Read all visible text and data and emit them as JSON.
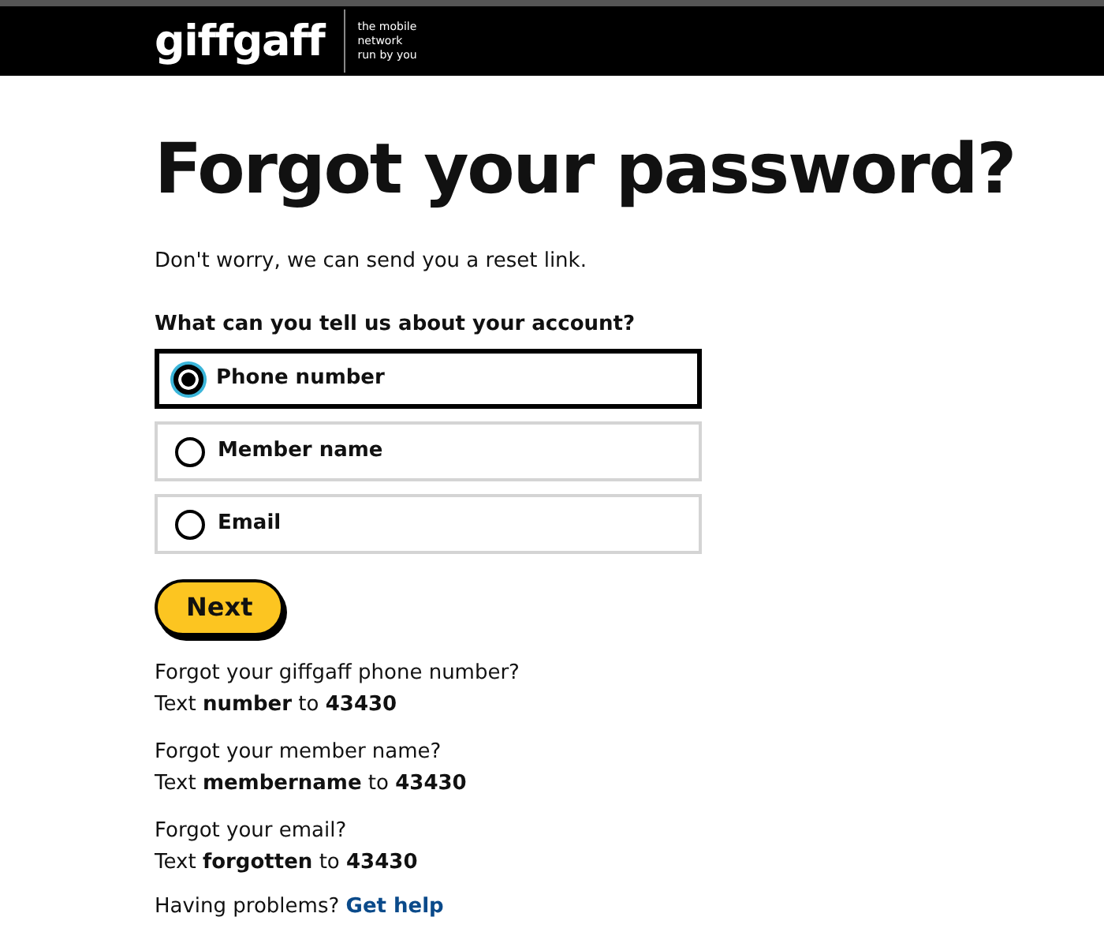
{
  "header": {
    "logo": "giffgaff",
    "tagline": [
      "the mobile",
      "network",
      "run by you"
    ]
  },
  "title": "Forgot your password?",
  "intro": "Don't worry, we can send you a reset link.",
  "question": "What can you tell us about your account?",
  "options": [
    {
      "label": "Phone number",
      "selected": true
    },
    {
      "label": "Member name",
      "selected": false
    },
    {
      "label": "Email",
      "selected": false
    }
  ],
  "next_button": "Next",
  "tips": [
    {
      "question": "Forgot your giffgaff phone number?",
      "instruction": "Text **number** to **43430**"
    },
    {
      "question": "Forgot your member name?",
      "instruction": "Text **membername** to **43430**"
    },
    {
      "question": "Forgot your email?",
      "instruction": "Text **forgotten** to **43430**"
    }
  ],
  "help": {
    "text": "Having problems?",
    "link": "Get help"
  }
}
